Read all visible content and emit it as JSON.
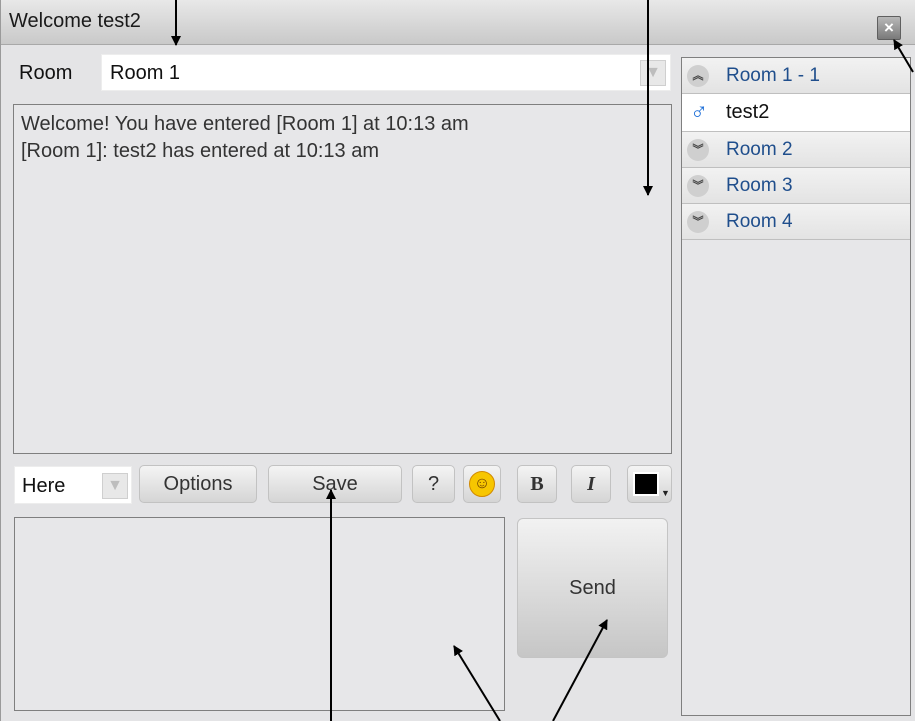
{
  "window": {
    "title": "Welcome test2",
    "close_icon": "close-icon"
  },
  "room_selector": {
    "label": "Room",
    "value": "Room 1"
  },
  "messages": [
    "Welcome! You have entered [Room 1] at 10:13 am",
    "[Room 1]: test2 has entered at 10:13 am"
  ],
  "sidebar": {
    "rooms": [
      {
        "name": "Room 1 - 1",
        "expanded": true,
        "users": [
          {
            "name": "test2",
            "gender_icon": "male-icon",
            "icon_color": "#1e6fd8"
          }
        ]
      },
      {
        "name": "Room 2",
        "expanded": false
      },
      {
        "name": "Room 3",
        "expanded": false
      },
      {
        "name": "Room 4",
        "expanded": false
      }
    ]
  },
  "toolbar": {
    "target_select": "Here",
    "options_label": "Options",
    "save_label": "Save",
    "help_label": "?",
    "bold_label": "B",
    "italic_label": "I",
    "color_value": "#000000"
  },
  "compose": {
    "value": ""
  },
  "send_label": "Send",
  "colors": {
    "room_link": "#1f4e8c",
    "panel_bg": "#e7e7e9",
    "border": "#7f7f7f"
  }
}
